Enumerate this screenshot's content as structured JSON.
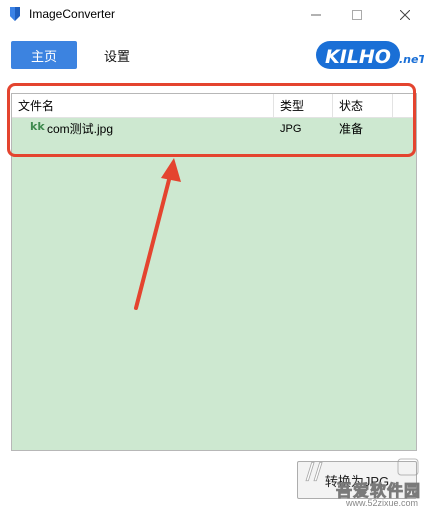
{
  "window": {
    "title": "ImageConverter",
    "controls": {
      "minimize": "—",
      "maximize": "☐",
      "close": "✕"
    }
  },
  "tabs": [
    {
      "label": "主页",
      "active": true
    },
    {
      "label": "设置",
      "active": false
    }
  ],
  "logo": {
    "text": "KILHO",
    "suffix": ".neT",
    "color": "#1a6fd6"
  },
  "file_list": {
    "columns": [
      "文件名",
      "类型",
      "状态"
    ],
    "rows": [
      {
        "icon": "kk-image-icon",
        "icon_text": "kk",
        "name": "com测试.jpg",
        "type": "JPG",
        "status": "准备"
      }
    ],
    "background": "#cde8d0"
  },
  "convert_button": {
    "label": "转换为JPG"
  },
  "annotation": {
    "color": "#e4442f"
  },
  "watermark": {
    "text": "吾爱软件园",
    "url": "www.52zixue.com"
  },
  "colors": {
    "accent": "#3c83e0"
  }
}
